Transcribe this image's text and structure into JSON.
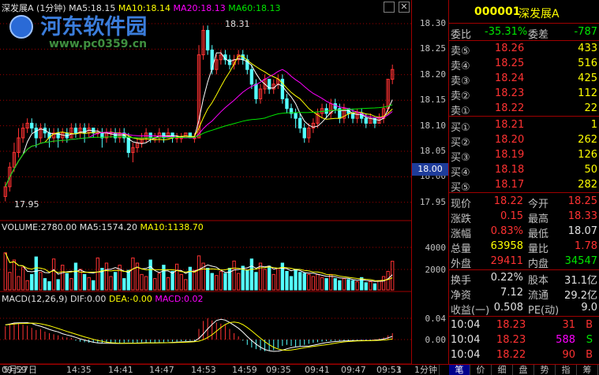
{
  "top_legend": {
    "name": "深发展A (1分钟)",
    "ma5": "MA5:18.15",
    "ma10": "MA10:18.14",
    "ma20": "MA20:18.13",
    "ma60": "MA60:18.13"
  },
  "vol_legend": {
    "volume": "VOLUME:2780.00",
    "ma5": "MA5:1574.20",
    "ma10": "MA10:1138.70"
  },
  "macd_legend": {
    "name": "MACD(12,26,9)",
    "dif": "DIF:0.00",
    "dea": "DEA:-0.00",
    "macd": "MACD:0.02"
  },
  "price_axis": [
    "18.30",
    "18.25",
    "18.20",
    "18.15",
    "18.10",
    "18.05",
    "18.00",
    "17.95"
  ],
  "current_price_tag": "18.00",
  "vol_axis": [
    "4000",
    "2000"
  ],
  "macd_axis": [
    "0.04",
    "0.00"
  ],
  "annot_high": "18.31",
  "annot_low": "17.95",
  "time_labels": [
    "5月27日",
    "14:35",
    "14:41",
    "14:47",
    "14:53",
    "14:59",
    "09:35",
    "09:41",
    "09:47",
    "09:53",
    "09:59",
    "1"
  ],
  "period_tab": "1分钟",
  "right_tabs": [
    "笔",
    "价",
    "细",
    "盘",
    "势",
    "指",
    "筹"
  ],
  "watermark": {
    "title": "河东软件园",
    "url": "www.pc0359.cn"
  },
  "stock": {
    "code": "000001",
    "name": "深发展A"
  },
  "weibi": {
    "label": "委比",
    "value": "-35.31%",
    "diff_label": "委差",
    "diff": "-787"
  },
  "sells": [
    {
      "label": "卖⑤",
      "price": "18.26",
      "vol": "433"
    },
    {
      "label": "卖④",
      "price": "18.25",
      "vol": "516"
    },
    {
      "label": "卖③",
      "price": "18.24",
      "vol": "425"
    },
    {
      "label": "卖②",
      "price": "18.23",
      "vol": "112"
    },
    {
      "label": "卖①",
      "price": "18.22",
      "vol": "22"
    }
  ],
  "buys": [
    {
      "label": "买①",
      "price": "18.21",
      "vol": "1"
    },
    {
      "label": "买②",
      "price": "18.20",
      "vol": "262"
    },
    {
      "label": "买③",
      "price": "18.19",
      "vol": "126"
    },
    {
      "label": "买④",
      "price": "18.18",
      "vol": "50"
    },
    {
      "label": "买⑤",
      "price": "18.17",
      "vol": "282"
    }
  ],
  "quote": [
    {
      "l1": "现价",
      "v1": "18.22",
      "l2": "今开",
      "v2": "18.25",
      "c1": "red",
      "c2": "red"
    },
    {
      "l1": "涨跌",
      "v1": "0.15",
      "l2": "最高",
      "v2": "18.33",
      "c1": "red",
      "c2": "red"
    },
    {
      "l1": "涨幅",
      "v1": "0.83%",
      "l2": "最低",
      "v2": "18.07",
      "c1": "red",
      "c2": "wht"
    },
    {
      "l1": "总量",
      "v1": "63958",
      "l2": "量比",
      "v2": "1.78",
      "c1": "yel",
      "c2": "red"
    },
    {
      "l1": "外盘",
      "v1": "29411",
      "l2": "内盘",
      "v2": "34547",
      "c1": "red",
      "c2": "grn"
    }
  ],
  "finance": [
    {
      "l1": "换手",
      "v1": "0.22%",
      "l2": "股本",
      "v2": "31.1亿"
    },
    {
      "l1": "净资",
      "v1": "7.12",
      "l2": "流通",
      "v2": "29.2亿"
    },
    {
      "l1": "收益(一)",
      "v1": "0.508",
      "l2": "PE(动)",
      "v2": "9.0"
    }
  ],
  "ticks": [
    {
      "time": "10:04",
      "price": "18.23",
      "vol": "31",
      "bs": "B",
      "vc": "red"
    },
    {
      "time": "10:04",
      "price": "18.23",
      "vol": "588",
      "bs": "S",
      "vc": "mag"
    },
    {
      "time": "10:04",
      "price": "18.22",
      "vol": "90",
      "bs": "B",
      "vc": "red"
    }
  ],
  "colors": {
    "up": "#ff3232",
    "down": "#54ffff",
    "grid": "#a00000",
    "ma5": "#ffffff",
    "ma10": "#ffff00",
    "ma20": "#ff00ff",
    "ma60": "#00e600"
  },
  "chart_data": {
    "type": "candlestick",
    "price_min": 17.93,
    "price_max": 18.33,
    "candles": [
      [
        17.96,
        17.98,
        17.95,
        17.99
      ],
      [
        17.98,
        18.02,
        17.97,
        18.03
      ],
      [
        18.02,
        18.05,
        18.01,
        18.07
      ],
      [
        18.05,
        18.08,
        18.04,
        18.1
      ],
      [
        18.08,
        18.1,
        18.07,
        18.11
      ],
      [
        18.1,
        18.11,
        18.09,
        18.12
      ],
      [
        18.11,
        18.1,
        18.09,
        18.12
      ],
      [
        18.1,
        18.08,
        18.06,
        18.11
      ],
      [
        18.08,
        18.1,
        18.07,
        18.11
      ],
      [
        18.1,
        18.09,
        18.08,
        18.11
      ],
      [
        18.09,
        18.08,
        18.06,
        18.1
      ],
      [
        18.08,
        18.09,
        18.07,
        18.1
      ],
      [
        18.09,
        18.08,
        18.06,
        18.1
      ],
      [
        18.08,
        18.09,
        18.07,
        18.1
      ],
      [
        18.09,
        18.08,
        18.07,
        18.1
      ],
      [
        18.08,
        18.1,
        18.08,
        18.11
      ],
      [
        18.1,
        18.09,
        18.08,
        18.11
      ],
      [
        18.09,
        18.1,
        18.08,
        18.11
      ],
      [
        18.1,
        18.09,
        18.07,
        18.11
      ],
      [
        18.09,
        18.1,
        18.08,
        18.11
      ],
      [
        18.1,
        18.09,
        18.08,
        18.1
      ],
      [
        18.09,
        18.09,
        18.08,
        18.1
      ],
      [
        18.09,
        18.08,
        18.06,
        18.1
      ],
      [
        18.08,
        18.09,
        18.07,
        18.1
      ],
      [
        18.09,
        18.09,
        18.08,
        18.1
      ],
      [
        18.09,
        18.08,
        18.07,
        18.1
      ],
      [
        18.08,
        18.09,
        18.07,
        18.1
      ],
      [
        18.09,
        18.08,
        18.07,
        18.1
      ],
      [
        18.08,
        18.05,
        18.04,
        18.09
      ],
      [
        18.05,
        18.06,
        18.03,
        18.07
      ],
      [
        18.06,
        18.07,
        18.05,
        18.08
      ],
      [
        18.07,
        18.08,
        18.06,
        18.09
      ],
      [
        18.08,
        18.09,
        18.07,
        18.1
      ],
      [
        18.09,
        18.08,
        18.07,
        18.09
      ],
      [
        18.08,
        18.08,
        18.07,
        18.09
      ],
      [
        18.08,
        18.09,
        18.07,
        18.1
      ],
      [
        18.09,
        18.08,
        18.07,
        18.09
      ],
      [
        18.08,
        18.09,
        18.08,
        18.1
      ],
      [
        18.09,
        18.08,
        18.07,
        18.09
      ],
      [
        18.08,
        18.08,
        18.07,
        18.09
      ],
      [
        18.08,
        18.08,
        18.07,
        18.09
      ],
      [
        18.08,
        18.09,
        18.08,
        18.09
      ],
      [
        18.09,
        18.08,
        18.08,
        18.09
      ],
      [
        18.08,
        18.08,
        18.07,
        18.09
      ],
      [
        18.08,
        18.25,
        18.08,
        18.27
      ],
      [
        18.25,
        18.3,
        18.24,
        18.31
      ],
      [
        18.3,
        18.26,
        18.25,
        18.31
      ],
      [
        18.26,
        18.22,
        18.21,
        18.27
      ],
      [
        18.22,
        18.24,
        18.21,
        18.25
      ],
      [
        18.24,
        18.25,
        18.23,
        18.26
      ],
      [
        18.25,
        18.24,
        18.23,
        18.26
      ],
      [
        18.24,
        18.23,
        18.22,
        18.25
      ],
      [
        18.23,
        18.24,
        18.22,
        18.25
      ],
      [
        18.24,
        18.25,
        18.23,
        18.26
      ],
      [
        18.25,
        18.24,
        18.23,
        18.26
      ],
      [
        18.24,
        18.22,
        18.21,
        18.25
      ],
      [
        18.22,
        18.19,
        18.18,
        18.23
      ],
      [
        18.19,
        18.16,
        18.15,
        18.2
      ],
      [
        18.16,
        18.18,
        18.15,
        18.19
      ],
      [
        18.18,
        18.2,
        18.17,
        18.21
      ],
      [
        18.2,
        18.18,
        18.17,
        18.2
      ],
      [
        18.18,
        18.19,
        18.17,
        18.2
      ],
      [
        18.19,
        18.2,
        18.18,
        18.21
      ],
      [
        18.2,
        18.16,
        18.15,
        18.21
      ],
      [
        18.16,
        18.14,
        18.13,
        18.17
      ],
      [
        18.14,
        18.13,
        18.12,
        18.15
      ],
      [
        18.13,
        18.12,
        18.1,
        18.14
      ],
      [
        18.12,
        18.1,
        18.09,
        18.13
      ],
      [
        18.1,
        18.08,
        18.07,
        18.11
      ],
      [
        18.08,
        18.1,
        18.07,
        18.11
      ],
      [
        18.1,
        18.11,
        18.09,
        18.12
      ],
      [
        18.11,
        18.13,
        18.1,
        18.14
      ],
      [
        18.13,
        18.14,
        18.12,
        18.15
      ],
      [
        18.14,
        18.13,
        18.12,
        18.15
      ],
      [
        18.13,
        18.15,
        18.12,
        18.16
      ],
      [
        18.15,
        18.14,
        18.13,
        18.16
      ],
      [
        18.14,
        18.12,
        18.11,
        18.15
      ],
      [
        18.12,
        18.14,
        18.11,
        18.15
      ],
      [
        18.14,
        18.13,
        18.12,
        18.14
      ],
      [
        18.13,
        18.12,
        18.11,
        18.14
      ],
      [
        18.12,
        18.13,
        18.11,
        18.14
      ],
      [
        18.13,
        18.12,
        18.11,
        18.14
      ],
      [
        18.12,
        18.11,
        18.1,
        18.13
      ],
      [
        18.11,
        18.12,
        18.11,
        18.13
      ],
      [
        18.12,
        18.11,
        18.1,
        18.12
      ],
      [
        18.11,
        18.12,
        18.11,
        18.13
      ],
      [
        18.12,
        18.14,
        18.11,
        18.15
      ],
      [
        18.14,
        18.2,
        18.13,
        18.2
      ],
      [
        18.2,
        18.22,
        18.19,
        18.23
      ]
    ],
    "volumes": [
      3600,
      1700,
      2900,
      1300,
      2200,
      900,
      1500,
      3200,
      1700,
      1100,
      800,
      3000,
      1000,
      2400,
      1600,
      1100,
      2600,
      2000,
      1500,
      1200,
      900,
      3100,
      2100,
      2600,
      1300,
      1700,
      2400,
      1100,
      1900,
      3100,
      2600,
      1500,
      1300,
      2900,
      1100,
      1600,
      2400,
      1200,
      1800,
      2500,
      1500,
      1000,
      2200,
      1900,
      3300,
      2600,
      2100,
      1600,
      1400,
      1800,
      1600,
      2100,
      2800,
      1600,
      2300,
      1900,
      3000,
      1700,
      2600,
      2000,
      2300,
      1500,
      2100,
      2600,
      1800,
      1300,
      2000,
      1700,
      1600,
      1500,
      1300,
      1500,
      1200,
      1100,
      1500,
      1100,
      900,
      1100,
      1000,
      900,
      800,
      1200,
      700,
      800,
      600,
      900,
      1300,
      1800,
      2780
    ],
    "macd_hist": [
      0.025,
      0.028,
      0.032,
      0.03,
      0.028,
      0.026,
      0.022,
      0.018,
      0.02,
      0.015,
      0.012,
      0.01,
      0.008,
      0.005,
      0.004,
      0.003,
      -0.002,
      -0.004,
      -0.005,
      -0.006,
      -0.006,
      -0.007,
      -0.007,
      -0.006,
      -0.006,
      -0.007,
      -0.007,
      -0.006,
      -0.005,
      -0.006,
      -0.006,
      -0.005,
      -0.005,
      -0.006,
      -0.006,
      -0.005,
      -0.005,
      -0.004,
      -0.004,
      -0.004,
      -0.003,
      -0.003,
      -0.002,
      -0.002,
      0.02,
      0.035,
      0.04,
      0.036,
      0.032,
      0.03,
      0.028,
      0.02,
      0.012,
      0.006,
      -0.002,
      -0.01,
      -0.015,
      -0.018,
      -0.02,
      -0.022,
      -0.021,
      -0.02,
      -0.016,
      -0.012,
      -0.01,
      -0.012,
      -0.013,
      -0.012,
      -0.01,
      -0.008,
      -0.006,
      -0.005,
      -0.004,
      -0.003,
      -0.003,
      -0.002,
      -0.002,
      -0.002,
      -0.002,
      -0.002,
      -0.001,
      -0.002,
      -0.002,
      -0.001,
      0.001,
      0.002,
      0.004,
      0.008,
      0.012
    ]
  }
}
